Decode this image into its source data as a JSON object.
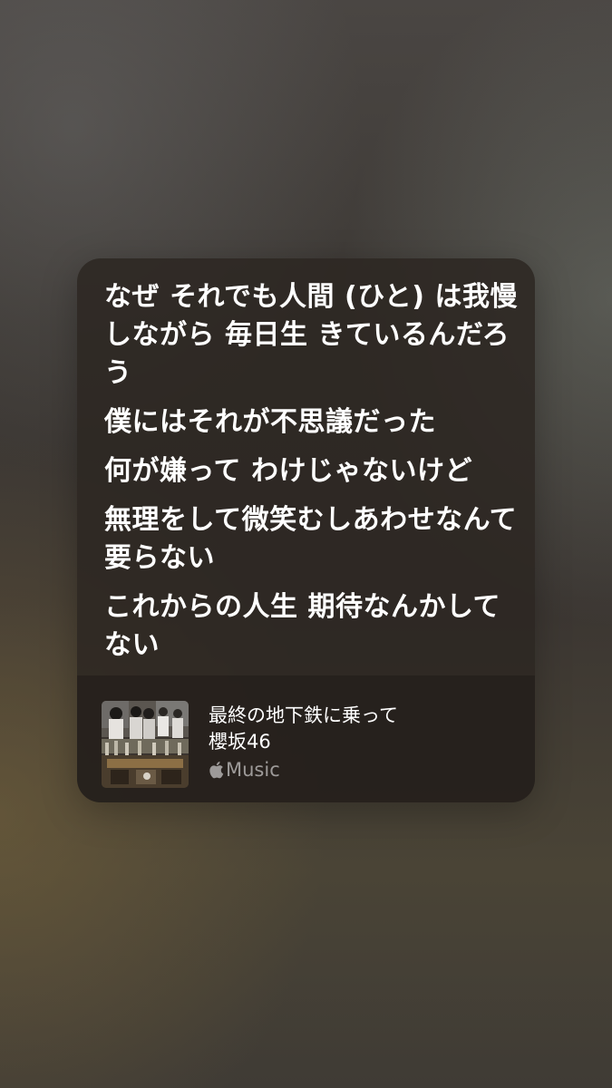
{
  "lyrics": [
    "なぜ それでも人間 (ひと) は我慢しながら 毎日生 きているんだろう",
    "僕にはそれが不思議だった",
    "何が嫌って わけじゃないけど",
    "無理をして微笑むしあわせなんて要らない",
    "これからの人生 期待なんかしてない"
  ],
  "track": {
    "title": "最終の地下鉄に乗って",
    "artist": "櫻坂46",
    "service_label": "Music",
    "service_icon": "apple-logo-icon"
  },
  "colors": {
    "card_background": "#2c2622",
    "text_primary": "#ffffff",
    "text_secondary": "#8c8784"
  }
}
